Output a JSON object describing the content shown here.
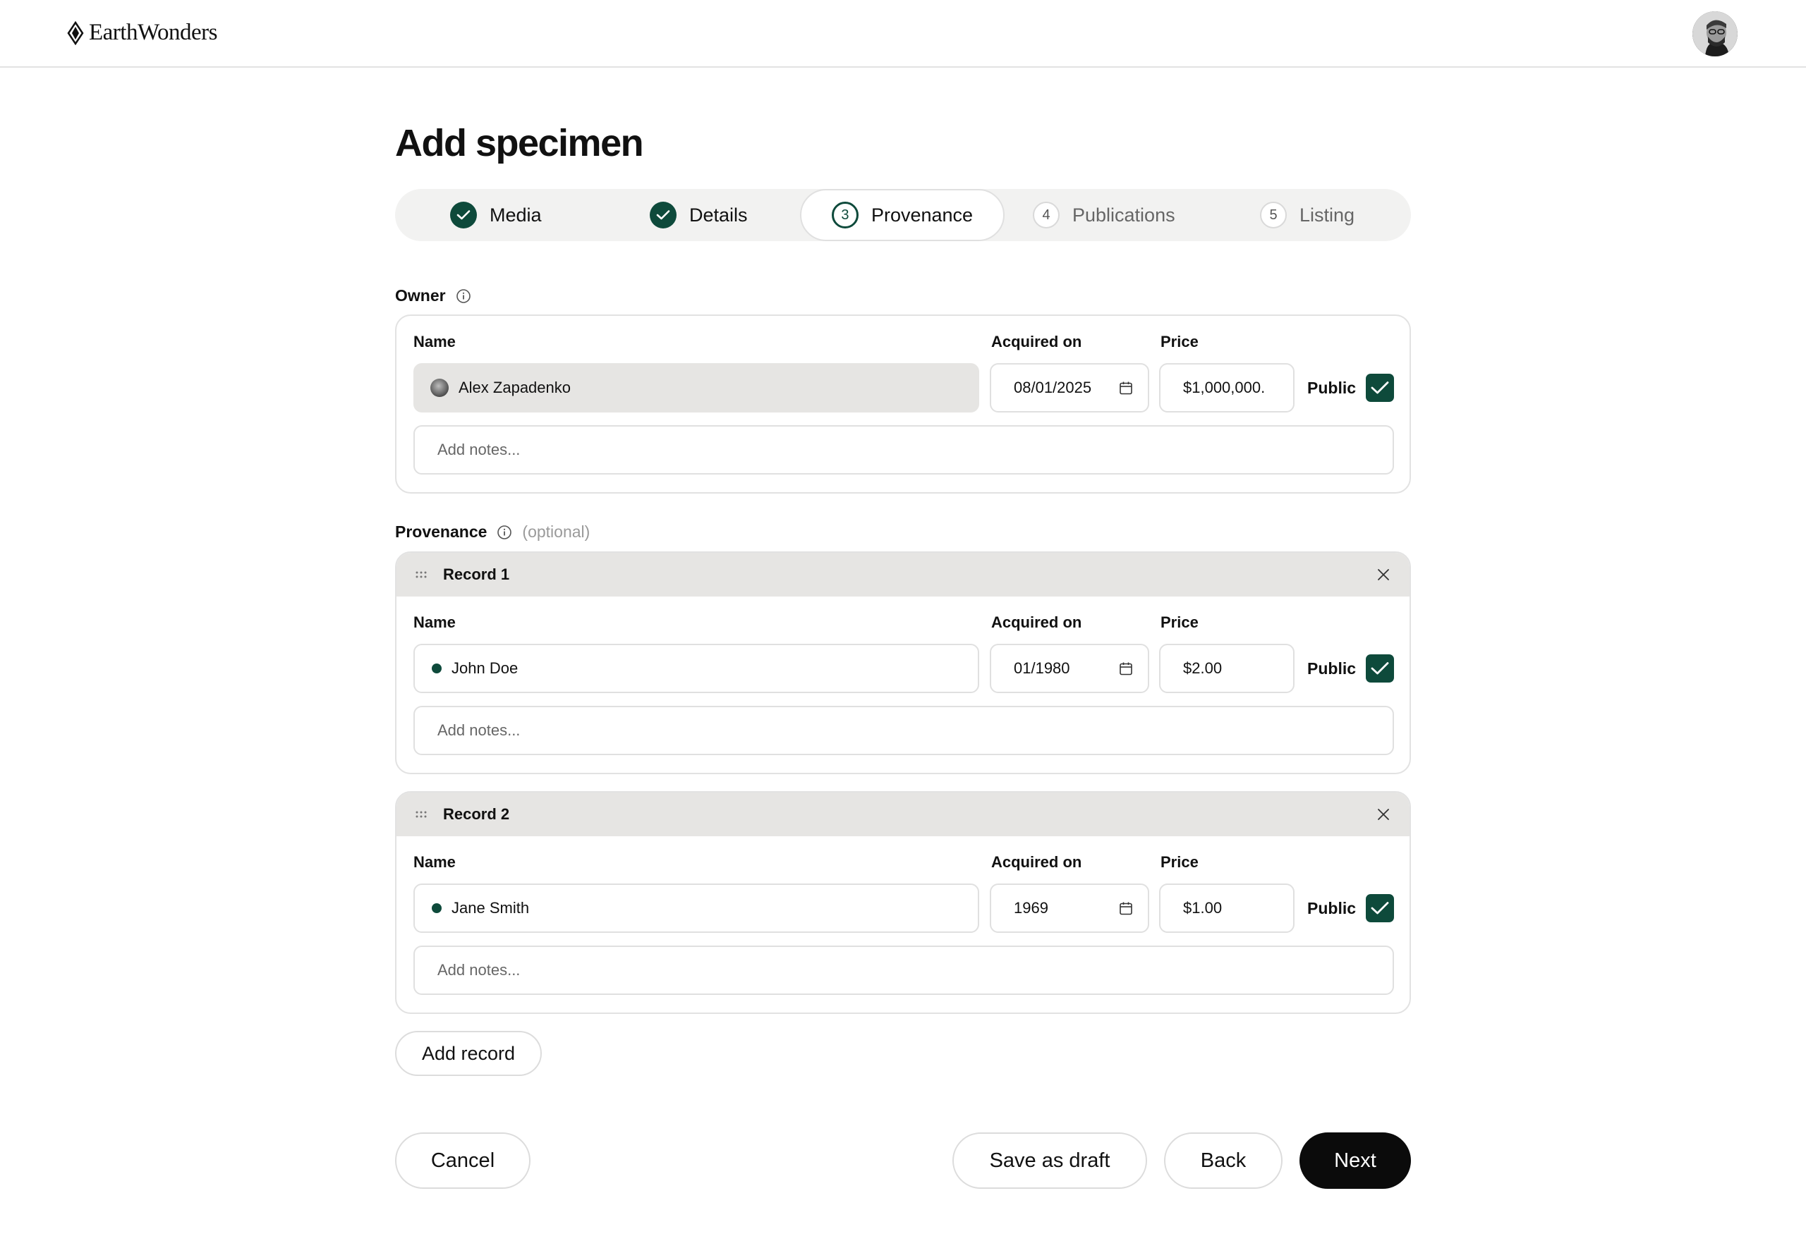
{
  "app": {
    "brand": "EarthWonders"
  },
  "page": {
    "title": "Add specimen"
  },
  "stepper": {
    "steps": [
      {
        "label": "Media",
        "state": "done"
      },
      {
        "label": "Details",
        "state": "done"
      },
      {
        "label": "Provenance",
        "state": "active",
        "number": "3"
      },
      {
        "label": "Publications",
        "state": "todo",
        "number": "4"
      },
      {
        "label": "Listing",
        "state": "todo",
        "number": "5"
      }
    ]
  },
  "owner": {
    "section_label": "Owner",
    "name_label": "Name",
    "acquired_label": "Acquired on",
    "price_label": "Price",
    "name": "Alex Zapadenko",
    "acquired_on": "08/01/2025",
    "price": "$1,000,000.",
    "public_label": "Public",
    "public": true,
    "notes_placeholder": "Add notes..."
  },
  "provenance": {
    "section_label": "Provenance",
    "optional_label": "(optional)",
    "records": [
      {
        "title": "Record 1",
        "name_label": "Name",
        "acquired_label": "Acquired on",
        "price_label": "Price",
        "name": "John Doe",
        "acquired_on": "01/1980",
        "price": "$2.00",
        "public_label": "Public",
        "public": true,
        "notes_placeholder": "Add notes..."
      },
      {
        "title": "Record 2",
        "name_label": "Name",
        "acquired_label": "Acquired on",
        "price_label": "Price",
        "name": "Jane Smith",
        "acquired_on": "1969",
        "price": "$1.00",
        "public_label": "Public",
        "public": true,
        "notes_placeholder": "Add notes..."
      }
    ],
    "add_record_label": "Add record"
  },
  "footer": {
    "cancel_label": "Cancel",
    "save_draft_label": "Save as draft",
    "back_label": "Back",
    "next_label": "Next"
  },
  "colors": {
    "accent": "#0e4a3b",
    "primary_button": "#0b0b0b",
    "header_fill": "#e6e5e3"
  }
}
